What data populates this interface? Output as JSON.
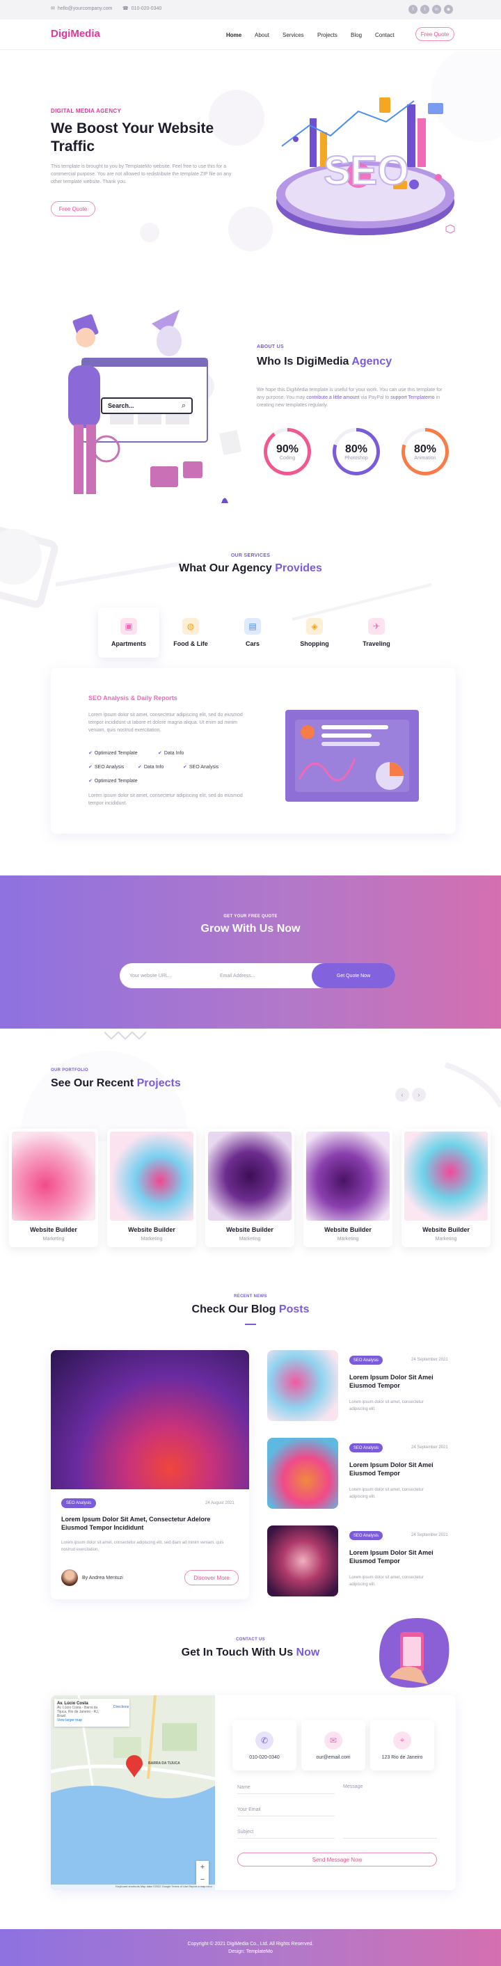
{
  "topbar": {
    "email": "hello@yourcompany.com",
    "phone": "010-020-0340",
    "social_icons": [
      "facebook-icon",
      "twitter-icon",
      "linkedin-icon",
      "rss-icon"
    ]
  },
  "header": {
    "logo": "DigiMedia",
    "nav": [
      "Home",
      "About",
      "Services",
      "Projects",
      "Blog",
      "Contact"
    ],
    "cta": "Free Quote"
  },
  "hero": {
    "eyebrow": "DIGITAL MEDIA AGENCY",
    "title_line1": "We Boost Your Website",
    "title_line2": "Traffic",
    "text": "This template is brought to you by TemplateMo website. Feel free to use this for a commercial purpose. You are not allowed to redistribute the template ZIP file on any other template website. Thank you.",
    "button": "Free Quote",
    "illustration_text": "SEO"
  },
  "about": {
    "eyebrow": "ABOUT US",
    "title_a": "Who Is DigiMedia",
    "title_b": "Agency",
    "text_a": "We hope this DigiMedia template is useful for your work. You can use this template for any purpose. You may",
    "link1": "contribute a little amount",
    "text_b": "via PayPal to",
    "link2": "support Templatemo",
    "text_c": "in creating new templates regularly.",
    "search_placeholder": "Search...",
    "stats": [
      {
        "value": "90%",
        "label": "Coding",
        "percent": 90,
        "color": "#f0588f"
      },
      {
        "value": "80%",
        "label": "Photoshop",
        "percent": 80,
        "color": "#7a5bd9"
      },
      {
        "value": "80%",
        "label": "Animation",
        "percent": 80,
        "color": "#f87c48"
      }
    ]
  },
  "services": {
    "eyebrow": "OUR SERVICES",
    "title_a": "What Our Agency",
    "title_b": "Provides",
    "tabs": [
      {
        "label": "Apartments",
        "icon": "building-icon",
        "color": "#f06ab7"
      },
      {
        "label": "Food & Life",
        "icon": "food-icon",
        "color": "#f4a11c"
      },
      {
        "label": "Cars",
        "icon": "car-icon",
        "color": "#4a8cf0"
      },
      {
        "label": "Shopping",
        "icon": "shopping-icon",
        "color": "#f4a11c"
      },
      {
        "label": "Traveling",
        "icon": "travel-icon",
        "color": "#f06ab7"
      }
    ],
    "panel": {
      "title": "SEO Analysis & Daily Reports",
      "text1": "Lorem ipsum dolor sit amet, consectetur adipiscing elit, sed do eiusmod tempor incididunt ut labore et dolore magna aliqua. Ut enim ad minim veniam, quis nostrud exercitation.",
      "checks": [
        "Optimized Template",
        "Data Info",
        "SEO Analysis",
        "Data Info",
        "SEO Analysis",
        "Optimized Template"
      ],
      "text2": "Lorem ipsum dolor sit amet, consectetur adipiscing elit, sed do eiusmod tempor incididunt."
    }
  },
  "cta": {
    "eyebrow": "GET YOUR FREE QUOTE",
    "title": "Grow With Us Now",
    "url_placeholder": "Your website URL...",
    "email_placeholder": "Email Address...",
    "button": "Get Quote Now"
  },
  "portfolio": {
    "eyebrow": "OUR PORTFOLIO",
    "title_a": "See Our Recent",
    "title_b": "Projects",
    "items": [
      {
        "title": "Website Builder",
        "sub": "Marketing"
      },
      {
        "title": "Website Builder",
        "sub": "Marketing"
      },
      {
        "title": "Website Builder",
        "sub": "Marketing"
      },
      {
        "title": "Website Builder",
        "sub": "Marketing"
      },
      {
        "title": "Website Builder",
        "sub": "Marketing"
      }
    ]
  },
  "blog": {
    "eyebrow": "RECENT NEWS",
    "title_a": "Check Our Blog",
    "title_b": "Posts",
    "featured": {
      "badge": "SEO Analysis",
      "date": "24 August 2021",
      "title": "Lorem Ipsum Dolor Sit Amet, Consectetur Adelore Eiusmod Tempor Incididunt",
      "text": "Lorem ipsum dolor sit amet, consectetur adipiscing elit, sed diam ad minim veniam, quis nostrud exercitation.",
      "author": "By Andrea Mentuzi",
      "button": "Discover More"
    },
    "posts": [
      {
        "badge": "SEO Analysis",
        "date": "24 September 2021",
        "title": "Lorem Ipsum Dolor Sit Amei Eiusmod Tempor",
        "text": "Lorem ipsum dolor sit amet, consectetur adipiscing elit."
      },
      {
        "badge": "SEO Analysis",
        "date": "24 September 2021",
        "title": "Lorem Ipsum Dolor Sit Amei Eiusmod Tempor",
        "text": "Lorem ipsum dolor sit amet, consectetur adipiscing elit."
      },
      {
        "badge": "SEO Analysis",
        "date": "24 September 2021",
        "title": "Lorem Ipsum Dolor Sit Amei Eiusmod Tempor",
        "text": "Lorem ipsum dolor sit amet, consectetur adipiscing elit."
      }
    ]
  },
  "contact": {
    "eyebrow": "CONTACT US",
    "title_a": "Get In Touch With Us",
    "title_b": "Now",
    "map_place": "Av. Lúcio Costa",
    "map_address": "Av. Lúcio Costa - Barra da Tijuca, Rio de Janeiro - RJ, Brazil",
    "map_link": "View larger map",
    "map_directions": "Directions",
    "map_area": "BARRA DA TIJUCA",
    "map_footer": "Keyboard shortcuts   Map data ©2022 Google   Terms of Use   Report a map error",
    "info": [
      {
        "icon": "phone-icon",
        "value": "010-020-0340",
        "color": "#7a5bd9"
      },
      {
        "icon": "email-icon",
        "value": "our@email.com",
        "color": "#f06ab7"
      },
      {
        "icon": "location-icon",
        "value": "123 Rio de Janeiro",
        "color": "#f06ab7"
      }
    ],
    "name_placeholder": "Name",
    "email_placeholder": "Your Email",
    "subject_placeholder": "Subject",
    "message_placeholder": "Message",
    "button": "Send Message Now"
  },
  "footer": {
    "copyright": "Copyright © 2021 DigiMedia Co., Ltd. All Rights Reserved.",
    "design": "Design: TemplateMo"
  }
}
